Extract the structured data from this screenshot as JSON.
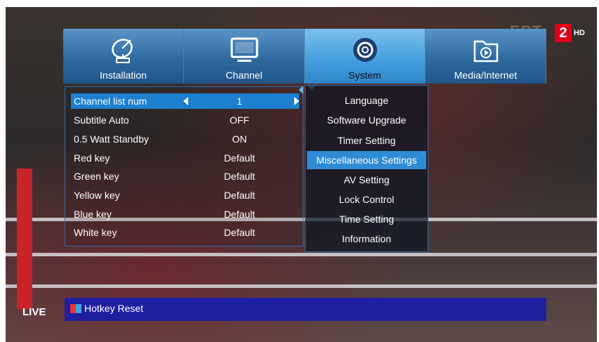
{
  "overlay": {
    "live": "LIVE",
    "channel_logo": "ΕΡΤ",
    "channel_number": "2",
    "hd": "HD"
  },
  "tabs": [
    {
      "label": "Installation",
      "icon": "satellite-dish-icon"
    },
    {
      "label": "Channel",
      "icon": "tv-monitor-icon"
    },
    {
      "label": "System",
      "icon": "gear-icon"
    },
    {
      "label": "Media/Internet",
      "icon": "media-folder-icon"
    }
  ],
  "settings": [
    {
      "name": "Channel list num",
      "value": "1"
    },
    {
      "name": "Subtitle Auto",
      "value": "OFF"
    },
    {
      "name": "0.5 Watt Standby",
      "value": "ON"
    },
    {
      "name": "Red key",
      "value": "Default"
    },
    {
      "name": "Green key",
      "value": "Default"
    },
    {
      "name": "Yellow key",
      "value": "Default"
    },
    {
      "name": "Blue key",
      "value": "Default"
    },
    {
      "name": "White key",
      "value": "Default"
    }
  ],
  "submenu": [
    "Language",
    "Software Upgrade",
    "Timer Setting",
    "Miscellaneous Settings",
    "AV Setting",
    "Lock Control",
    "Time Setting",
    "Information"
  ],
  "footer": {
    "hotkey_label": "Hotkey Reset"
  },
  "colors": {
    "selection": "#1c7fd0",
    "submenu_selection": "#2e8bd6",
    "footer": "#1d1fa0"
  }
}
